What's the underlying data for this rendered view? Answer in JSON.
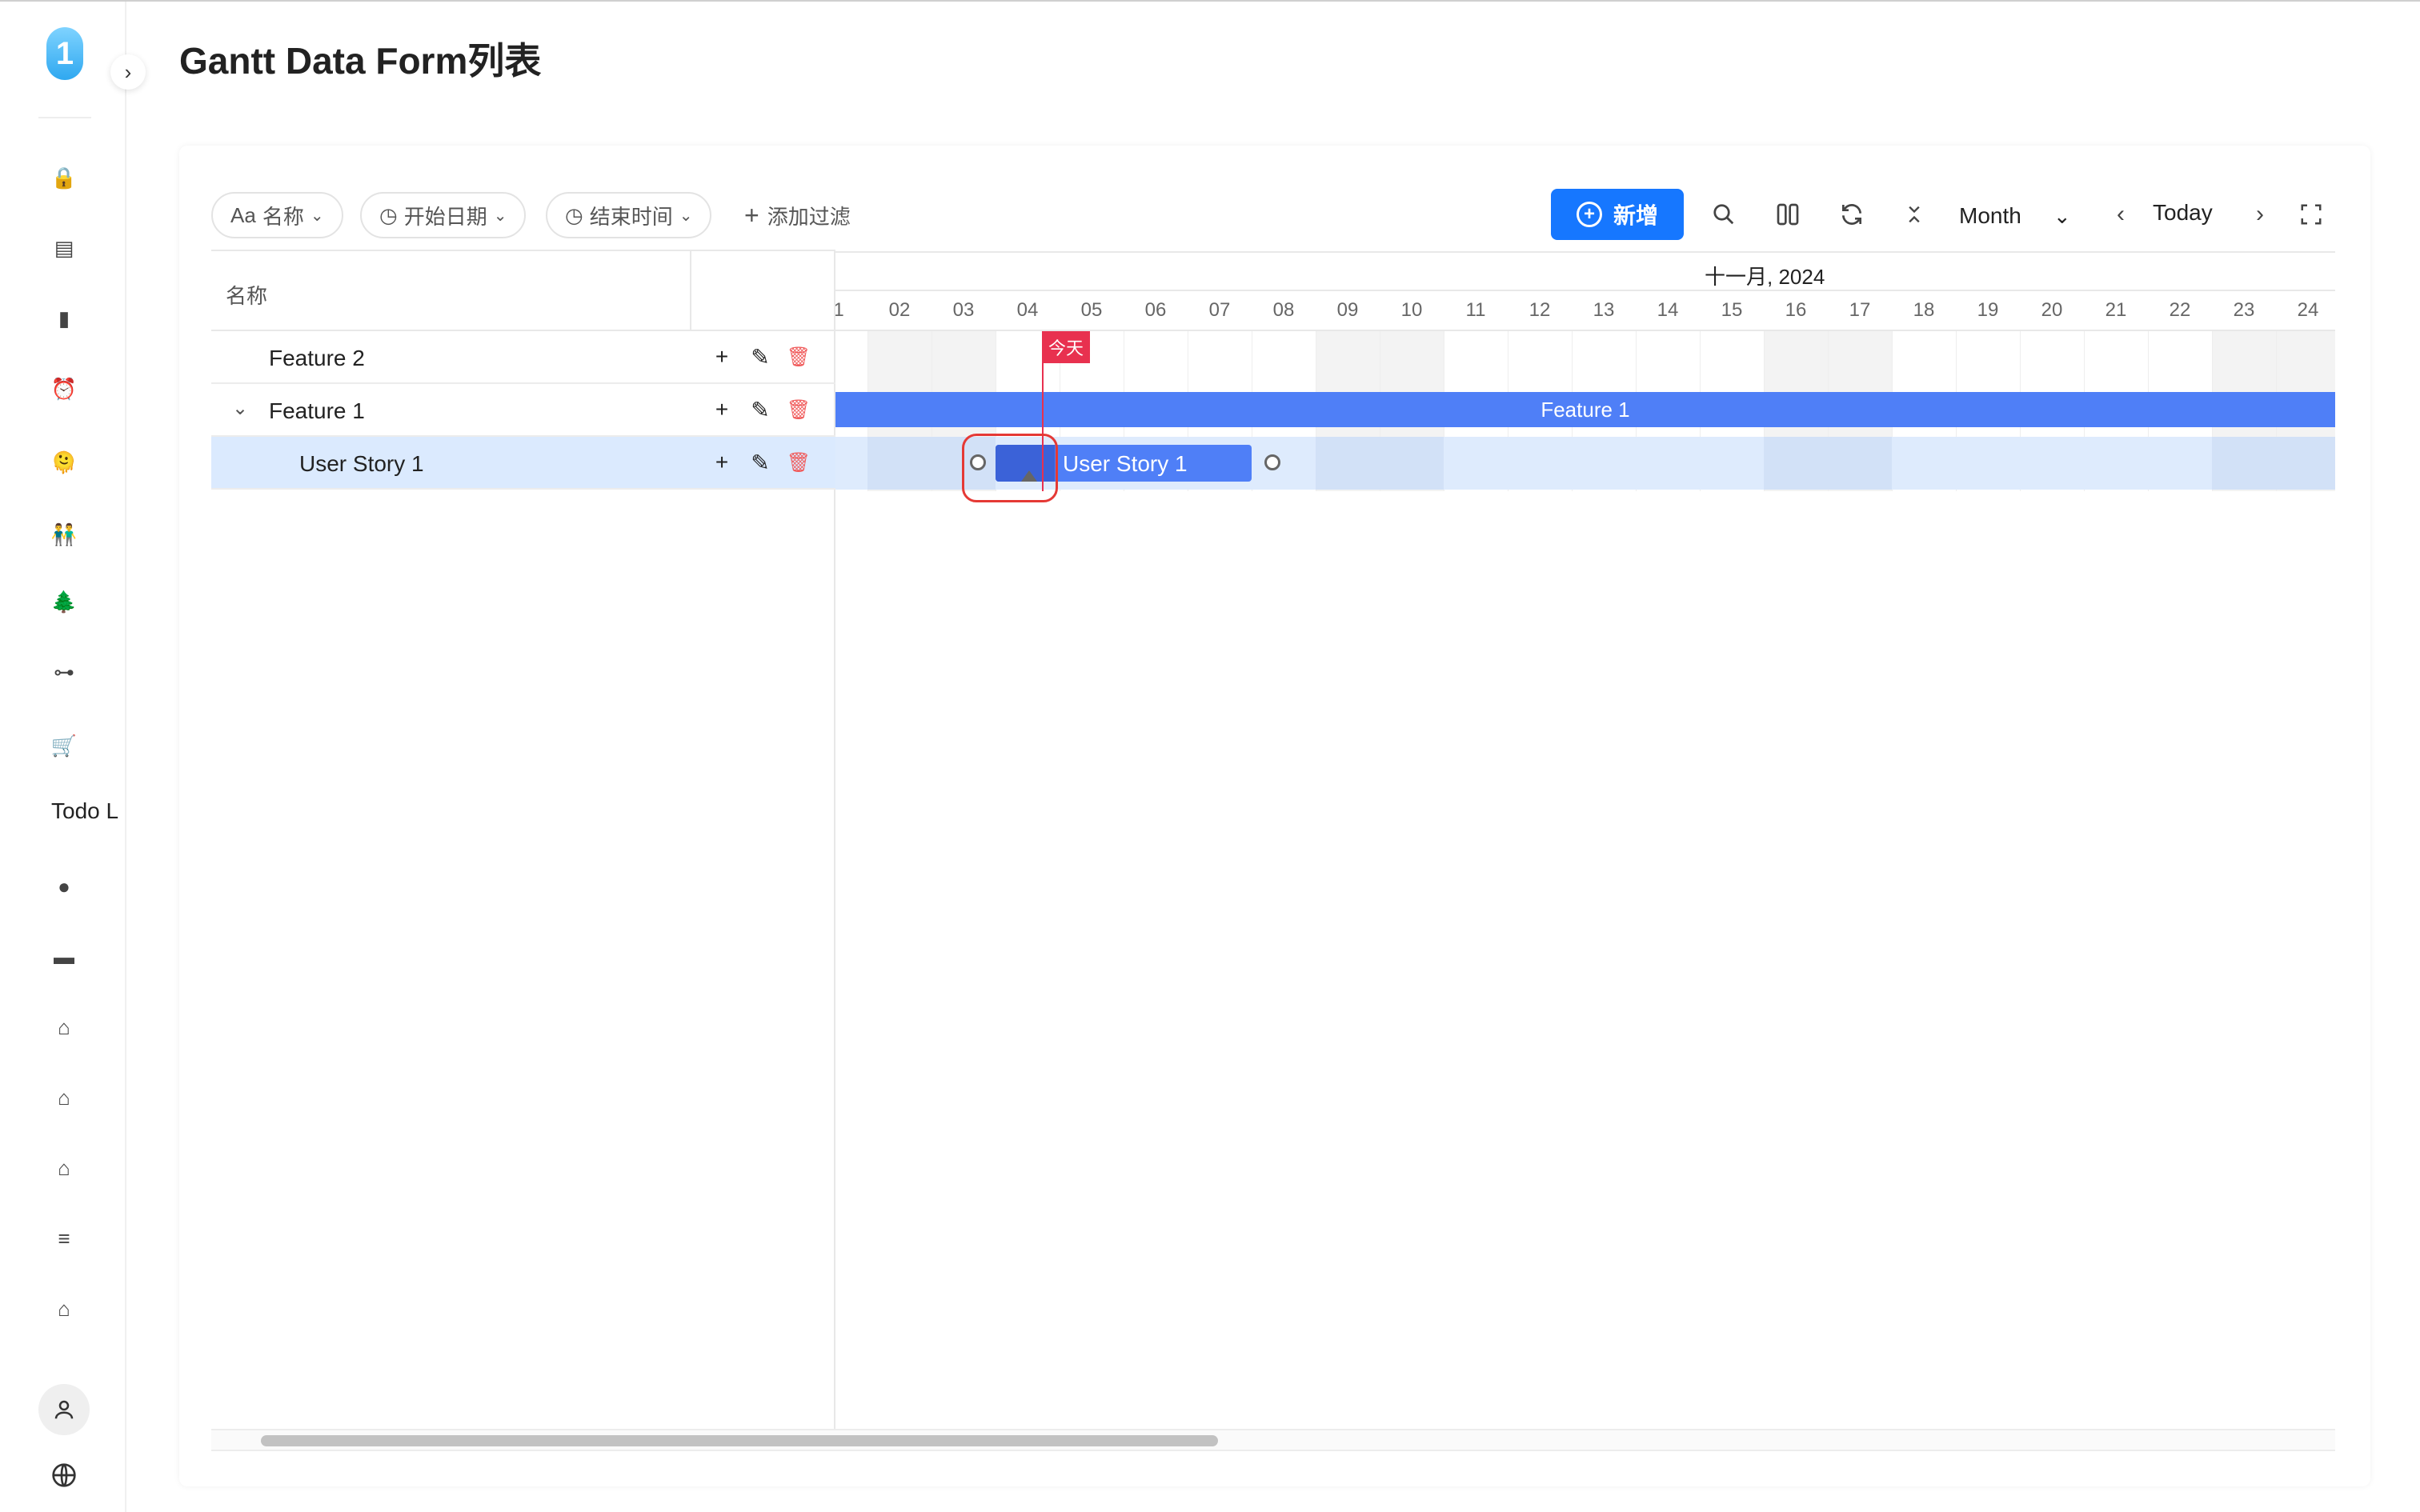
{
  "page": {
    "title": "Gantt Data Form列表"
  },
  "sidebar": {
    "logo": "1",
    "collapse_icon": "chevron-right-icon",
    "items": [
      {
        "icon": "lock-icon",
        "glyph": "🔒"
      },
      {
        "icon": "ledger-icon",
        "glyph": "▤"
      },
      {
        "icon": "bottle-icon",
        "glyph": "▮"
      },
      {
        "icon": "clock-icon",
        "glyph": "⏰"
      },
      {
        "icon": "emoji-icon",
        "glyph": "🫠"
      },
      {
        "icon": "people-icon",
        "glyph": "👬"
      },
      {
        "icon": "tree-icon",
        "glyph": "🌲"
      },
      {
        "icon": "flow-icon",
        "glyph": "⊶"
      },
      {
        "icon": "cart-icon",
        "glyph": "🛒"
      },
      {
        "icon": "globe-ball-icon",
        "glyph": "●"
      },
      {
        "icon": "folder-icon",
        "glyph": "▬"
      },
      {
        "icon": "home-icon",
        "glyph": "⌂"
      },
      {
        "icon": "home-icon",
        "glyph": "⌂"
      },
      {
        "icon": "home-icon",
        "glyph": "⌂"
      },
      {
        "icon": "menu-icon",
        "glyph": "≡"
      },
      {
        "icon": "home-outline-icon",
        "glyph": "⌂"
      }
    ],
    "text_item": "Todo L",
    "avatar_icon": "user-icon",
    "globe_icon": "globe-icon"
  },
  "filters": [
    {
      "prefix": "Aa",
      "label": "名称"
    },
    {
      "prefix": "◷",
      "label": "开始日期"
    },
    {
      "prefix": "◷",
      "label": "结束时间"
    }
  ],
  "add_filter": {
    "icon": "+",
    "label": "添加过滤"
  },
  "toolbar": {
    "new_label": "新增",
    "view_mode": "Month",
    "today_label": "Today"
  },
  "grid": {
    "header_name": "名称",
    "rows": [
      {
        "name": "Feature 2",
        "level": 0,
        "expandable": false,
        "selected": false
      },
      {
        "name": "Feature 1",
        "level": 0,
        "expandable": true,
        "selected": false
      },
      {
        "name": "User Story 1",
        "level": 1,
        "expandable": false,
        "selected": true
      }
    ]
  },
  "timeline": {
    "month_label": "十一月, 2024",
    "days": [
      "1",
      "02",
      "03",
      "04",
      "05",
      "06",
      "07",
      "08",
      "09",
      "10",
      "11",
      "12",
      "13",
      "14",
      "15",
      "16",
      "17",
      "18",
      "19",
      "20",
      "21",
      "22",
      "23",
      "24"
    ],
    "weekend_days": [
      "02",
      "03",
      "09",
      "10",
      "16",
      "17",
      "23",
      "24"
    ],
    "today_label": "今天",
    "today_day": "04",
    "bars": [
      {
        "task": "Feature 1",
        "label": "Feature 1"
      },
      {
        "task": "User Story 1",
        "label": "User Story 1",
        "start_day": "03",
        "end_day": "07"
      }
    ]
  },
  "colors": {
    "primary": "#1677ff",
    "bar": "#4f7ff7",
    "bar_progress": "#3b62d8",
    "today": "#e8314f",
    "highlight": "#e53935",
    "selected_row": "#dbeafe"
  }
}
